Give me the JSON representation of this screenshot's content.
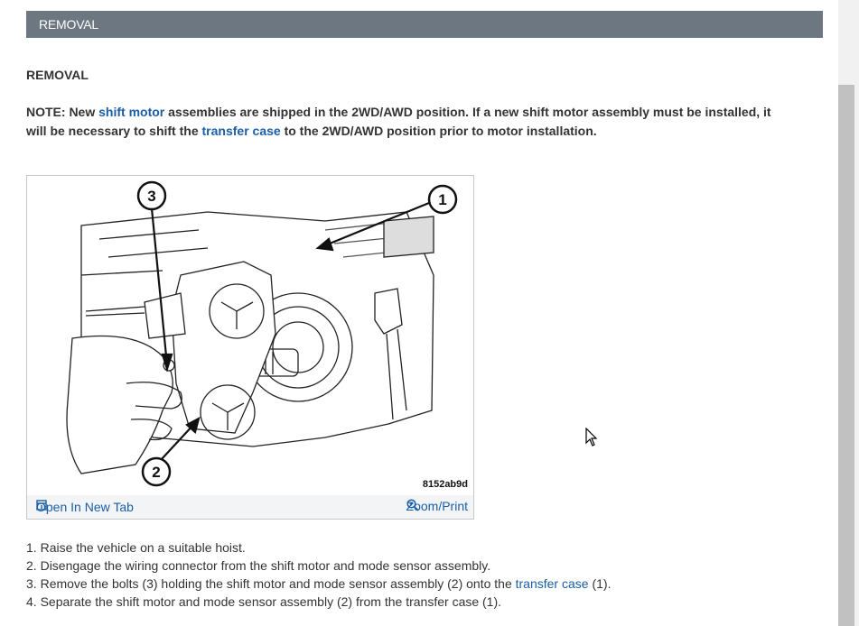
{
  "banner": {
    "title": "REMOVAL"
  },
  "section": {
    "heading": "REMOVAL"
  },
  "note": {
    "prefix": "NOTE: New ",
    "link1": "shift motor",
    "middle": " assemblies are shipped in the 2WD/AWD position. If a new shift motor assembly must be installed, it will be necessary to shift the ",
    "link2": "transfer case",
    "suffix": " to the 2WD/AWD position prior to motor installation."
  },
  "figure": {
    "id": "8152ab9d",
    "callouts": [
      "1",
      "2",
      "3"
    ],
    "open_label": "Open In New Tab",
    "zoom_label": "Zoom/Print"
  },
  "steps": [
    {
      "num": "1.",
      "text": "Raise the vehicle on a suitable hoist."
    },
    {
      "num": "2.",
      "text": "Disengage the wiring connector from the shift motor and mode sensor assembly."
    },
    {
      "num": "3.",
      "pre": "Remove the bolts (3) holding the shift motor and mode sensor assembly (2) onto the ",
      "link": "transfer case",
      "post": " (1)."
    },
    {
      "num": "4.",
      "text": "Separate the shift motor and mode sensor assembly (2) from the transfer case (1)."
    }
  ],
  "icons": {
    "open": "open-in-new-tab-icon",
    "zoom": "zoom-icon",
    "cursor": "mouse-pointer-icon"
  },
  "colors": {
    "banner": "#6d7782",
    "link": "#1a5ea8",
    "text": "#333333"
  }
}
